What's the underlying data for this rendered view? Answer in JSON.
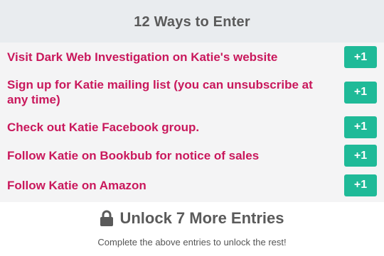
{
  "header": {
    "title": "12 Ways to Enter"
  },
  "entries": [
    {
      "label": "Visit Dark Web Investigation on Katie's website",
      "points": "+1"
    },
    {
      "label": "Sign up for Katie mailing list (you can unsubscribe at any time)",
      "points": "+1"
    },
    {
      "label": "Check out Katie Facebook group.",
      "points": "+1"
    },
    {
      "label": "Follow Katie on Bookbub for notice of sales",
      "points": "+1"
    },
    {
      "label": "Follow Katie on Amazon",
      "points": "+1"
    }
  ],
  "unlock": {
    "title": "Unlock 7 More Entries",
    "subtitle": "Complete the above entries to unlock the rest!",
    "icon": "lock-icon"
  },
  "colors": {
    "header_bg": "#e9ecef",
    "entry_text": "#c9185c",
    "badge_bg": "#1fba98",
    "badge_text": "#ffffff",
    "muted_text": "#5a5a5a"
  }
}
